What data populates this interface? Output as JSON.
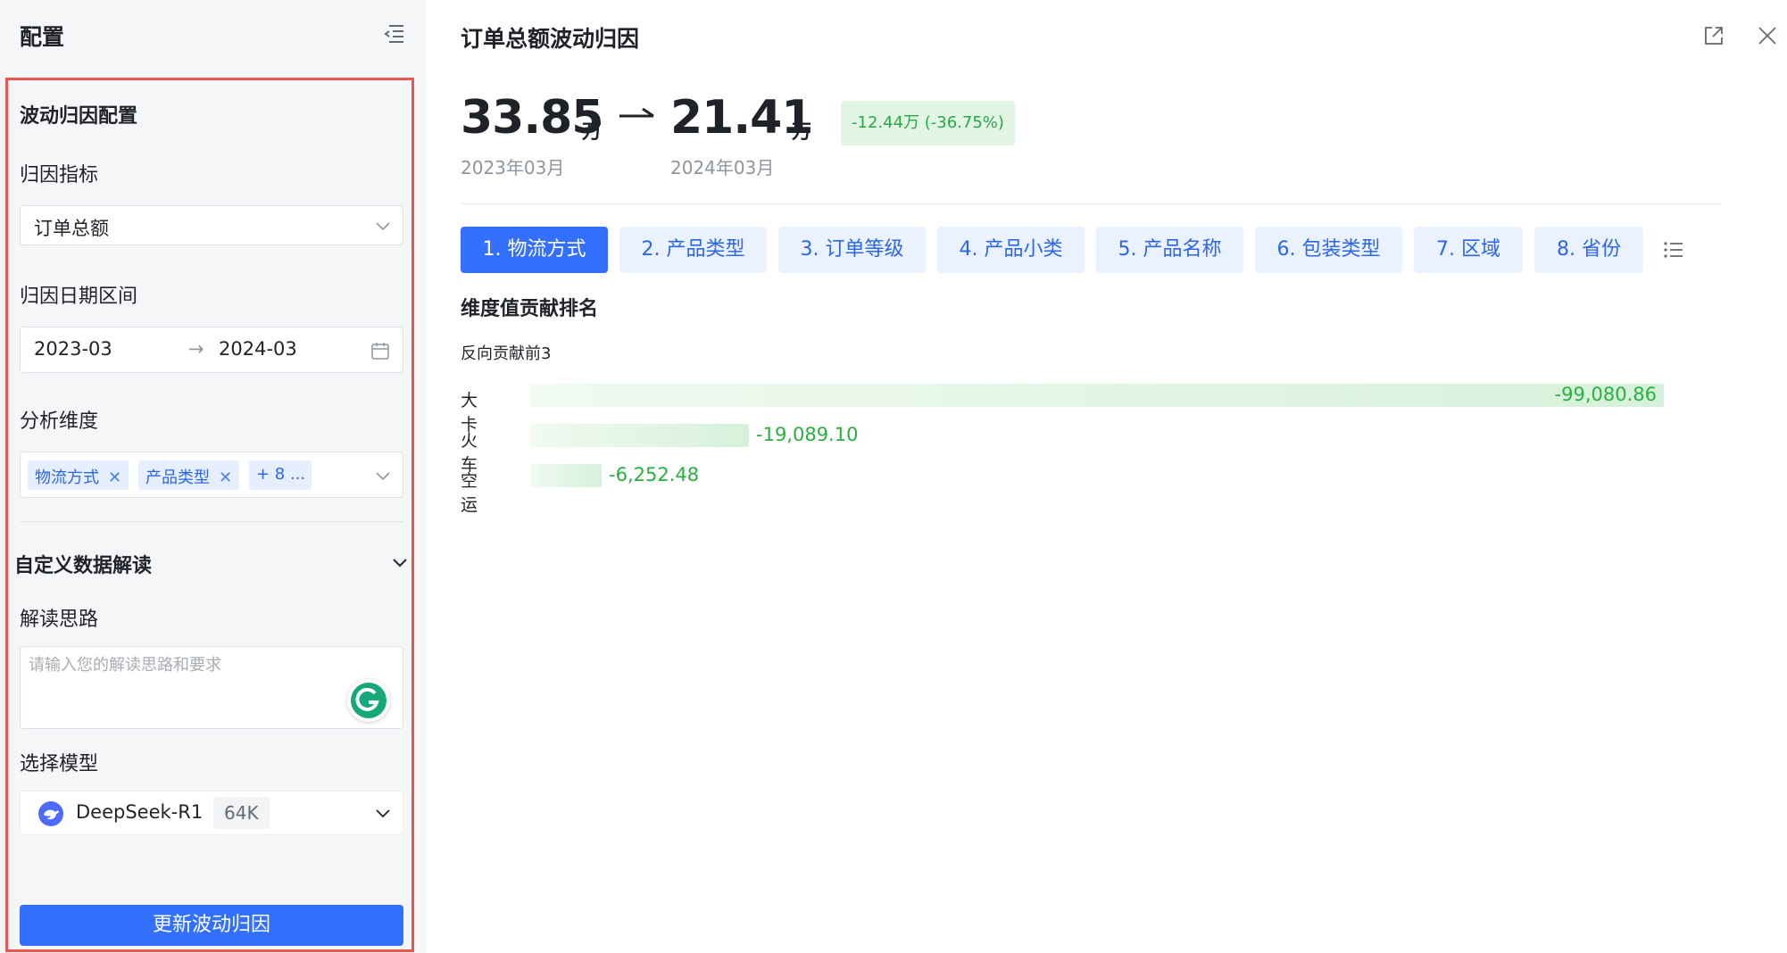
{
  "left": {
    "title": "配置",
    "section_title": "波动归因配置",
    "metric_label": "归因指标",
    "metric_value": "订单总额",
    "date_label": "归因日期区间",
    "date_start": "2023-03",
    "date_arrow": "→",
    "date_end": "2024-03",
    "dims_label": "分析维度",
    "dim_tags": [
      "物流方式",
      "产品类型",
      "+ 8 ..."
    ],
    "custom_section": "自定义数据解读",
    "thought_label": "解读思路",
    "thought_placeholder": "请输入您的解读思路和要求",
    "model_label": "选择模型",
    "model_name": "DeepSeek-R1",
    "model_context": "64K",
    "update_button": "更新波动归因"
  },
  "main": {
    "title": "订单总额波动归因",
    "from_value": "33.85",
    "from_unit": "万",
    "from_period": "2023年03月",
    "to_value": "21.41",
    "to_unit": "万",
    "to_period": "2024年03月",
    "delta": "-12.44万 (-36.75%)",
    "tabs": [
      "1. 物流方式",
      "2. 产品类型",
      "3. 订单等级",
      "4. 产品小类",
      "5. 产品名称",
      "6. 包装类型",
      "7. 区域",
      "8. 省份"
    ],
    "active_tab": 0,
    "rank_title": "维度值贡献排名",
    "rank_subtitle": "反向贡献前3"
  },
  "chart_data": {
    "type": "bar",
    "orientation": "horizontal",
    "categories": [
      "大卡",
      "火车",
      "空运"
    ],
    "values": [
      -99080.86,
      -19089.1,
      -6252.48
    ],
    "value_labels": [
      "-99,080.86",
      "-19,089.10",
      "-6,252.48"
    ],
    "title": "维度值贡献排名",
    "subtitle": "反向贡献前3",
    "color": "#28b13e"
  },
  "colors": {
    "primary": "#3370ff",
    "highlight_border": "#e8584f",
    "positive_green": "#28b13e"
  }
}
